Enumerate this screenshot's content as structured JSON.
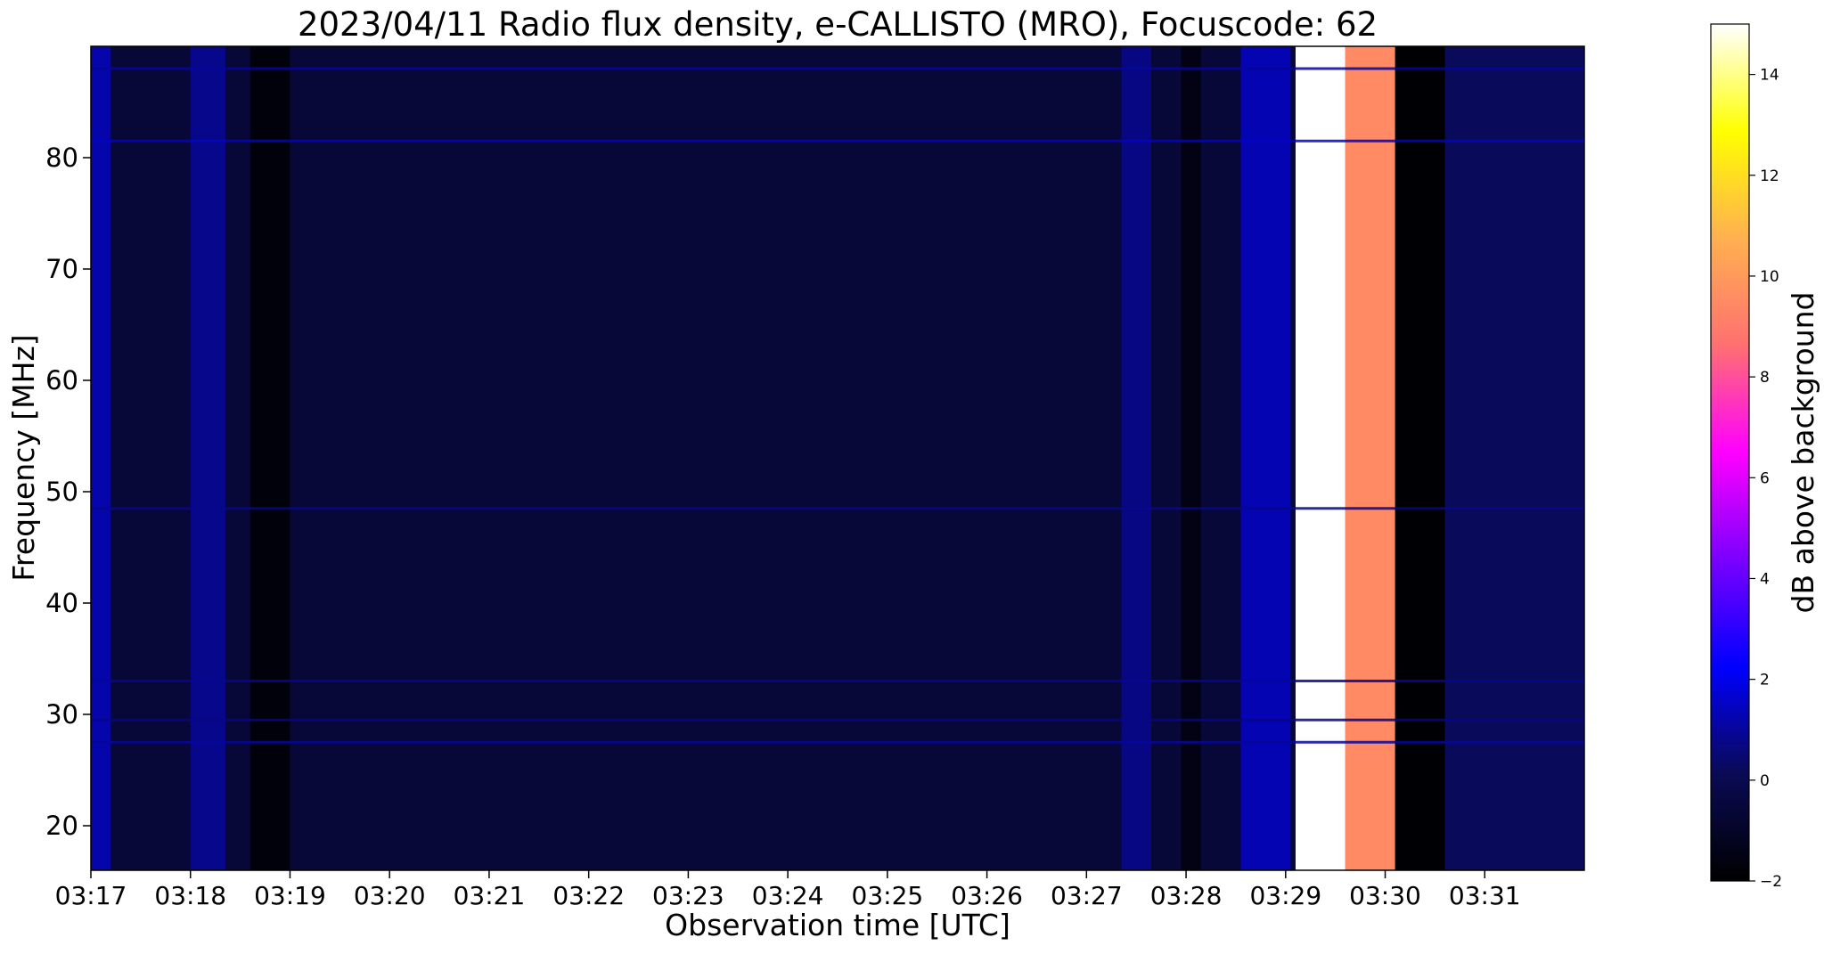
{
  "chart_data": {
    "type": "heatmap",
    "title": "2023/04/11  Radio flux density, e-CALLISTO (MRO), Focuscode: 62",
    "xlabel": "Observation time [UTC]",
    "ylabel": "Frequency [MHz]",
    "colorbar_label": "dB above background",
    "x_ticks": [
      "03:17",
      "03:18",
      "03:19",
      "03:20",
      "03:21",
      "03:22",
      "03:23",
      "03:24",
      "03:25",
      "03:26",
      "03:27",
      "03:28",
      "03:29",
      "03:30",
      "03:31"
    ],
    "x_tick_minutes": [
      0,
      1,
      2,
      3,
      4,
      5,
      6,
      7,
      8,
      9,
      10,
      11,
      12,
      13,
      14
    ],
    "xlim_minutes": [
      0,
      15
    ],
    "y_ticks": [
      20,
      30,
      40,
      50,
      60,
      70,
      80
    ],
    "ylim": [
      16,
      90
    ],
    "colorbar_ticks": [
      -2,
      0,
      2,
      4,
      6,
      8,
      10,
      12,
      14
    ],
    "clim": [
      -2,
      15
    ],
    "colormap": [
      "#000000",
      "#0a0a55",
      "#0000ff",
      "#7a00ff",
      "#ff00ff",
      "#ff7070",
      "#ffb050",
      "#ffff00",
      "#ffffff"
    ],
    "background_level": -0.6,
    "bands": [
      {
        "start": 0.0,
        "end": 0.2,
        "level": 1.2
      },
      {
        "start": 1.0,
        "end": 1.35,
        "level": 0.8
      },
      {
        "start": 1.6,
        "end": 2.0,
        "level": -1.7
      },
      {
        "start": 10.35,
        "end": 10.65,
        "level": 0.7
      },
      {
        "start": 10.95,
        "end": 11.15,
        "level": -1.5
      },
      {
        "start": 11.55,
        "end": 12.05,
        "level": 1.3
      },
      {
        "start": 12.1,
        "end": 12.6,
        "level": 15
      },
      {
        "start": 12.6,
        "end": 13.1,
        "level": 9.5
      },
      {
        "start": 13.1,
        "end": 13.6,
        "level": -1.9
      },
      {
        "start": 13.6,
        "end": 15.0,
        "level": 0.2
      }
    ],
    "horizontal_lines": [
      {
        "freq": 27.5,
        "level": 1.0
      },
      {
        "freq": 29.5,
        "level": 0.7
      },
      {
        "freq": 33,
        "level": 0.9
      },
      {
        "freq": 48.5,
        "level": 0.8
      },
      {
        "freq": 81.5,
        "level": 1.5
      },
      {
        "freq": 88,
        "level": 1.0
      }
    ]
  }
}
